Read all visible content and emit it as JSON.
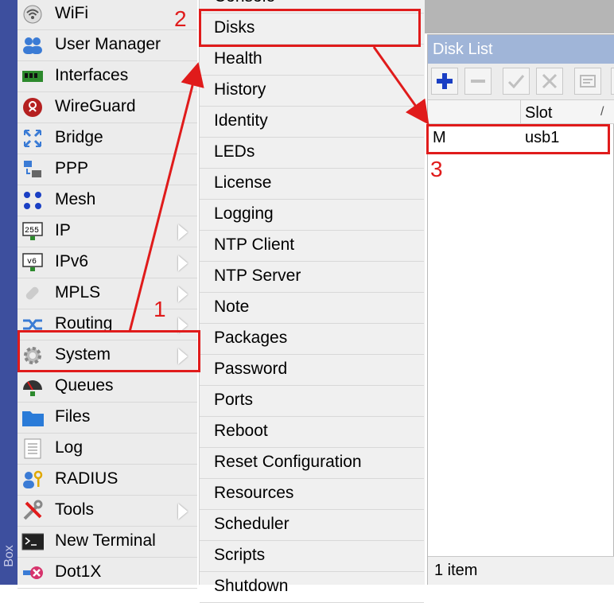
{
  "brand": "Box",
  "main_menu": [
    {
      "label": "WiFi",
      "icon": "wifi-icon",
      "submenu": false
    },
    {
      "label": "User Manager",
      "icon": "user-manager-icon",
      "submenu": false
    },
    {
      "label": "Interfaces",
      "icon": "interfaces-icon",
      "submenu": false
    },
    {
      "label": "WireGuard",
      "icon": "wireguard-icon",
      "submenu": false
    },
    {
      "label": "Bridge",
      "icon": "bridge-icon",
      "submenu": false
    },
    {
      "label": "PPP",
      "icon": "ppp-icon",
      "submenu": false
    },
    {
      "label": "Mesh",
      "icon": "mesh-icon",
      "submenu": false
    },
    {
      "label": "IP",
      "icon": "ip-icon",
      "icon_text": "255",
      "submenu": true
    },
    {
      "label": "IPv6",
      "icon": "ipv6-icon",
      "icon_text": "v6",
      "submenu": true
    },
    {
      "label": "MPLS",
      "icon": "mpls-icon",
      "submenu": true
    },
    {
      "label": "Routing",
      "icon": "routing-icon",
      "submenu": true
    },
    {
      "label": "System",
      "icon": "system-gear-icon",
      "submenu": true
    },
    {
      "label": "Queues",
      "icon": "queues-icon",
      "submenu": false
    },
    {
      "label": "Files",
      "icon": "folder-icon",
      "submenu": false
    },
    {
      "label": "Log",
      "icon": "log-icon",
      "submenu": false
    },
    {
      "label": "RADIUS",
      "icon": "radius-icon",
      "submenu": false
    },
    {
      "label": "Tools",
      "icon": "tools-icon",
      "submenu": true
    },
    {
      "label": "New Terminal",
      "icon": "terminal-icon",
      "submenu": false
    },
    {
      "label": "Dot1X",
      "icon": "dot1x-icon",
      "submenu": false
    }
  ],
  "system_submenu": [
    "Console",
    "Disks",
    "Health",
    "History",
    "Identity",
    "LEDs",
    "License",
    "Logging",
    "NTP Client",
    "NTP Server",
    "Note",
    "Packages",
    "Password",
    "Ports",
    "Reboot",
    "Reset Configuration",
    "Resources",
    "Scheduler",
    "Scripts",
    "Shutdown"
  ],
  "disk_list": {
    "title": "Disk List",
    "columns": [
      "Slot"
    ],
    "sort_glyph": "/",
    "rows": [
      {
        "name": "M",
        "slot": "usb1"
      }
    ],
    "status": "1 item"
  },
  "annotations": {
    "step1": "1",
    "step2": "2",
    "step3": "3",
    "color": "#e01b1b"
  },
  "colors": {
    "sidebar": "#3d4f9e",
    "titlebar": "#a0b5d8",
    "add_button": "#1a3fc4"
  }
}
